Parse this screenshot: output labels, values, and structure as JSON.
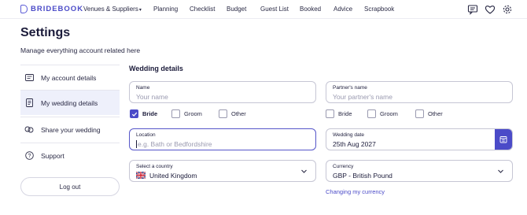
{
  "nav": {
    "brand": "BRIDEBOOK",
    "items": [
      {
        "label": "Venues & Suppliers",
        "caret": "▾"
      },
      {
        "label": "Planning"
      },
      {
        "label": "Checklist"
      },
      {
        "label": "Budget"
      },
      {
        "label": "Guest List"
      },
      {
        "label": "Booked"
      },
      {
        "label": "Advice"
      },
      {
        "label": "Scrapbook"
      }
    ],
    "icons": [
      "messages-icon",
      "heart-icon",
      "gear-icon"
    ]
  },
  "page": {
    "title": "Settings",
    "subtitle": "Manage everything account related here"
  },
  "sidebar": {
    "items": [
      {
        "label": "My account details",
        "icon": "id-card-icon",
        "active": false
      },
      {
        "label": "My wedding details",
        "icon": "document-icon",
        "active": true
      },
      {
        "label": "Share your wedding",
        "icon": "share-icon",
        "active": false
      },
      {
        "label": "Support",
        "icon": "question-icon",
        "active": false
      }
    ],
    "logout_label": "Log out"
  },
  "wedding": {
    "section_title": "Wedding details",
    "name": {
      "label": "Name",
      "placeholder": "Your name"
    },
    "partner_name": {
      "label": "Partner's name",
      "placeholder": "Your partner's name"
    },
    "name_roles": [
      {
        "label": "Bride",
        "checked": true
      },
      {
        "label": "Groom",
        "checked": false
      },
      {
        "label": "Other",
        "checked": false
      }
    ],
    "partner_roles": [
      {
        "label": "Bride",
        "checked": false
      },
      {
        "label": "Groom",
        "checked": false
      },
      {
        "label": "Other",
        "checked": false
      }
    ],
    "location": {
      "label": "Location",
      "placeholder": "e.g. Bath or Bedfordshire"
    },
    "wedding_date": {
      "label": "Wedding date",
      "value": "25th Aug 2027"
    },
    "country": {
      "label": "Select a country",
      "value": "United Kingdom"
    },
    "currency": {
      "label": "Currency",
      "value": "GBP - British Pound"
    },
    "change_currency_link": "Changing my currency"
  },
  "colors": {
    "accent": "#4b4bc8",
    "active_bg": "#eef0fb",
    "border": "#c6c6d4"
  }
}
